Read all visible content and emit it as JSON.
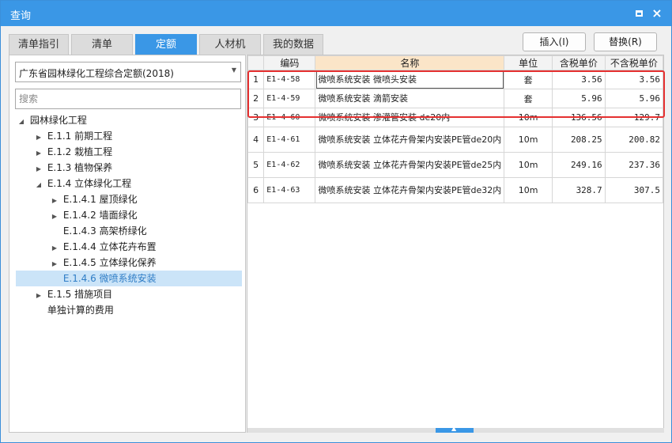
{
  "window": {
    "title": "查询"
  },
  "tabs": [
    {
      "label": "清单指引"
    },
    {
      "label": "清单"
    },
    {
      "label": "定额"
    },
    {
      "label": "人材机"
    },
    {
      "label": "我的数据"
    }
  ],
  "actions": {
    "insert_label": "插入(I)",
    "replace_label": "替换(R)"
  },
  "left": {
    "dropdown_value": "广东省园林绿化工程综合定额(2018)",
    "search_placeholder": "搜索",
    "tree": [
      {
        "label": "园林绿化工程",
        "toggle": "◢"
      },
      {
        "label": "E.1.1 前期工程",
        "toggle": "▶"
      },
      {
        "label": "E.1.2 栽植工程",
        "toggle": "▶"
      },
      {
        "label": "E.1.3 植物保养",
        "toggle": "▶"
      },
      {
        "label": "E.1.4 立体绿化工程",
        "toggle": "◢"
      },
      {
        "label": "E.1.4.1 屋顶绿化",
        "toggle": "▶"
      },
      {
        "label": "E.1.4.2 墙面绿化",
        "toggle": "▶"
      },
      {
        "label": "E.1.4.3 高架桥绿化",
        "toggle": ""
      },
      {
        "label": "E.1.4.4 立体花卉布置",
        "toggle": "▶"
      },
      {
        "label": "E.1.4.5 立体绿化保养",
        "toggle": "▶"
      },
      {
        "label": "E.1.4.6 微喷系统安装",
        "toggle": ""
      },
      {
        "label": "E.1.5 措施项目",
        "toggle": "▶"
      },
      {
        "label": "单独计算的费用",
        "toggle": ""
      }
    ]
  },
  "table": {
    "headers": [
      "",
      "编码",
      "名称",
      "单位",
      "含税单价",
      "不含税单价"
    ],
    "rows": [
      {
        "idx": "1",
        "code": "E1-4-58",
        "name": "微喷系统安装 微喷头安装",
        "unit": "套",
        "price_tax": "3.56",
        "price_notax": "3.56"
      },
      {
        "idx": "2",
        "code": "E1-4-59",
        "name": "微喷系统安装 滴箭安装",
        "unit": "套",
        "price_tax": "5.96",
        "price_notax": "5.96"
      },
      {
        "idx": "3",
        "code": "E1-4-60",
        "name": "微喷系统安装 渗灌管安装 de20内",
        "unit": "10m",
        "price_tax": "136.56",
        "price_notax": "129.7"
      },
      {
        "idx": "4",
        "code": "E1-4-61",
        "name": "微喷系统安装 立体花卉骨架内安装PE管de20内",
        "unit": "10m",
        "price_tax": "208.25",
        "price_notax": "200.82"
      },
      {
        "idx": "5",
        "code": "E1-4-62",
        "name": "微喷系统安装 立体花卉骨架内安装PE管de25内",
        "unit": "10m",
        "price_tax": "249.16",
        "price_notax": "237.36"
      },
      {
        "idx": "6",
        "code": "E1-4-63",
        "name": "微喷系统安装 立体花卉骨架内安装PE管de32内",
        "unit": "10m",
        "price_tax": "328.7",
        "price_notax": "307.5"
      }
    ]
  },
  "scrollbar": {
    "handle_glyph": "▲"
  },
  "colors": {
    "accent": "#3a97e6",
    "highlight_box": "#e53030",
    "selected_tree": "#cbe4f8"
  }
}
